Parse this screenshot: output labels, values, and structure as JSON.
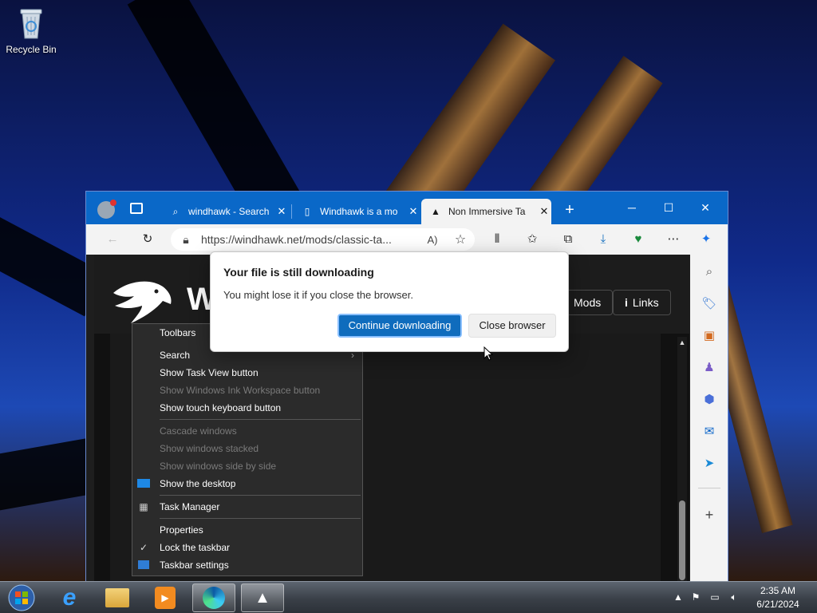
{
  "desktop": {
    "icons": [
      {
        "label": "Recycle Bin",
        "icon": "recycle-bin-icon"
      }
    ]
  },
  "browser": {
    "tabs": [
      {
        "title": "windhawk - Search",
        "icon": "search-icon"
      },
      {
        "title": "Windhawk is a mo",
        "icon": "page-icon"
      },
      {
        "title": "Non Immersive Ta",
        "icon": "windhawk-icon"
      }
    ],
    "url": "https://windhawk.net/mods/classic-ta...",
    "site": {
      "logo_letter": "W",
      "nav": [
        {
          "label": "Mods"
        },
        {
          "label": "Links",
          "icon": "info-icon"
        }
      ]
    }
  },
  "context_menu": {
    "items": [
      {
        "label": "Toolbars",
        "disabled": false,
        "submenu": true
      },
      {
        "label": "Search",
        "disabled": false,
        "submenu": true
      },
      {
        "label": "Show Task View button",
        "disabled": false
      },
      {
        "label": "Show Windows Ink Workspace button",
        "disabled": true
      },
      {
        "label": "Show touch keyboard button",
        "disabled": false
      },
      {
        "label": "Cascade windows",
        "disabled": true
      },
      {
        "label": "Show windows stacked",
        "disabled": true
      },
      {
        "label": "Show windows side by side",
        "disabled": true
      },
      {
        "label": "Show the desktop",
        "disabled": false,
        "icon": "desktop-icon"
      },
      {
        "label": "Task Manager",
        "disabled": false,
        "icon": "task-manager-icon"
      },
      {
        "label": "Properties",
        "disabled": false
      },
      {
        "label": "Lock the taskbar",
        "disabled": false,
        "checked": true
      },
      {
        "label": "Taskbar settings",
        "disabled": false,
        "icon": "settings-icon"
      }
    ]
  },
  "dialog": {
    "title": "Your file is still downloading",
    "message": "You might lose it if you close the browser.",
    "primary_label": "Continue downloading",
    "secondary_label": "Close browser"
  },
  "taskbar": {
    "apps": [
      "start-orb-icon",
      "internet-explorer-icon",
      "file-explorer-icon",
      "media-player-icon",
      "edge-icon",
      "windhawk-icon"
    ],
    "time": "2:35 AM",
    "date": "6/21/2024"
  },
  "colors": {
    "accent": "#0f6cbd",
    "tabstrip": "#0a68c8"
  }
}
